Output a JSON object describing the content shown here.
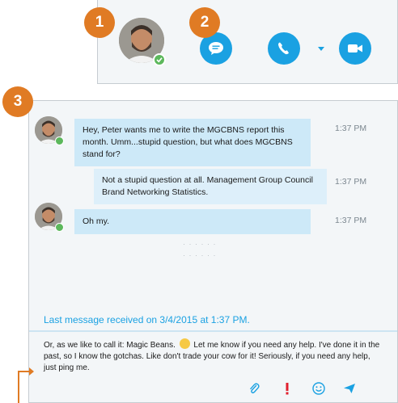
{
  "callouts": {
    "one": "1",
    "two": "2",
    "three": "3"
  },
  "toolbar": {
    "icons": [
      "chat-icon",
      "phone-icon",
      "video-icon"
    ],
    "accent": "#1aa1e2"
  },
  "messages": [
    {
      "text": "Hey, Peter wants me to write the MGCBNS report this month. Umm...stupid question, but what does MGCBNS stand for?",
      "time": "1:37 PM"
    },
    {
      "text": "Not a stupid question at all. Management Group Council Brand Networking Statistics.",
      "time": "1:37 PM"
    },
    {
      "text": "Oh my.",
      "time": "1:37 PM"
    }
  ],
  "last_received": "Last message received on 3/4/2015 at 1:37 PM.",
  "compose": {
    "before_emoji": "Or, as we like to call it: Magic Beans.",
    "after_emoji": "Let me know if you need any help. I've done it in the past, so I know the gotchas. Like don't trade your cow for it! Seriously, if you need any help, just ping me."
  },
  "colors": {
    "callout": "#e07b24",
    "presence": "#5cb85c",
    "bubble_in": "#cde9f8",
    "urgent": "#e0202e"
  }
}
